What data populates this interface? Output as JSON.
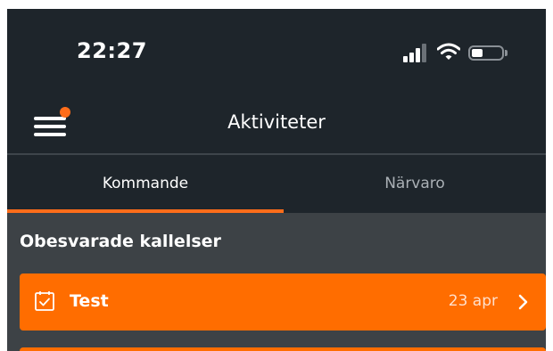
{
  "status_bar": {
    "time": "22:27"
  },
  "nav": {
    "title": "Aktiviteter"
  },
  "tabs": [
    {
      "label": "Kommande",
      "selected": true
    },
    {
      "label": "Närvaro",
      "selected": false
    }
  ],
  "section": {
    "title": "Obesvarade kallelser"
  },
  "items": [
    {
      "title": "Test",
      "date": "23 apr",
      "icon": "calendar-check-icon"
    }
  ],
  "colors": {
    "accent": "#ff6d00",
    "background": "#1e252b",
    "content_background": "#3d4246",
    "notification_dot": "#ff6d1a"
  },
  "icons": [
    "signal-icon",
    "wifi-icon",
    "battery-icon",
    "menu-icon",
    "calendar-check-icon",
    "chevron-right-icon"
  ]
}
